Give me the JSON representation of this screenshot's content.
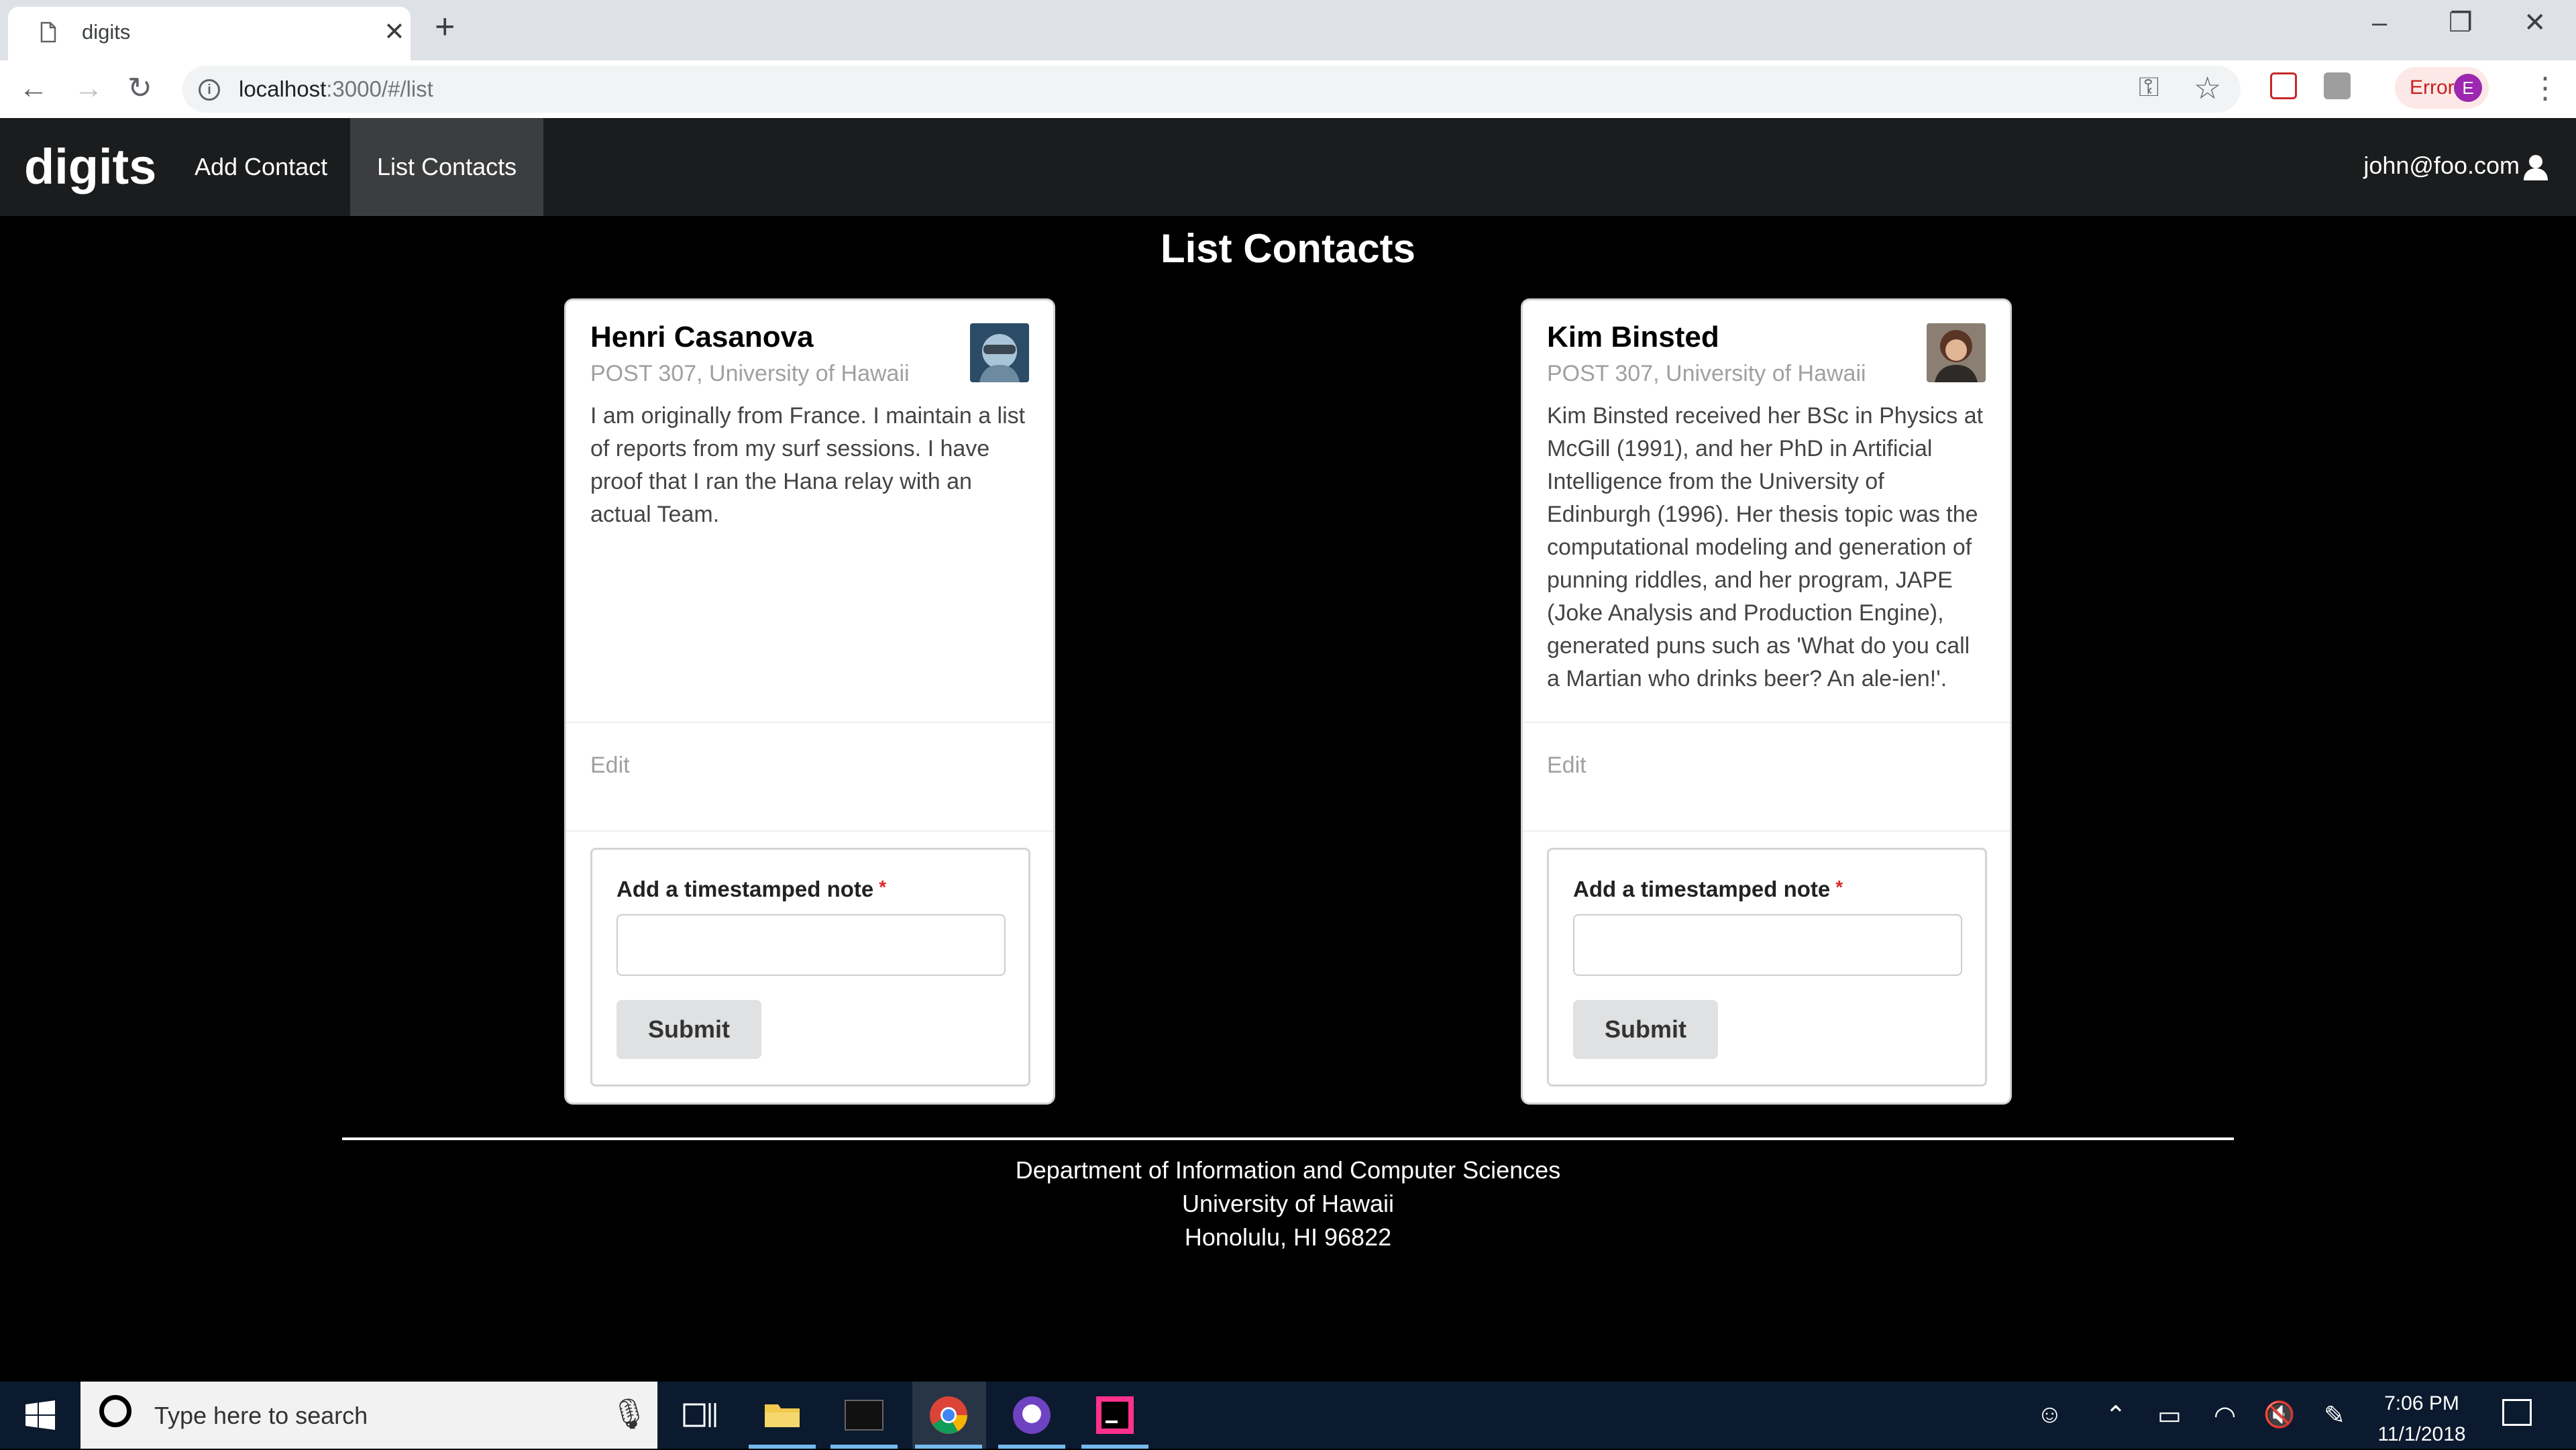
{
  "browser": {
    "tab_title": "digits",
    "url_host": "localhost",
    "url_rest": ":3000/#/list",
    "error_label": "Error",
    "profile_initial": "E"
  },
  "navbar": {
    "brand": "digits",
    "items": [
      {
        "label": "Add Contact",
        "active": false
      },
      {
        "label": "List Contacts",
        "active": true
      }
    ],
    "user": "john@foo.com"
  },
  "page": {
    "title": "List Contacts"
  },
  "contacts": [
    {
      "name": "Henri Casanova",
      "address": "POST 307, University of Hawaii",
      "description": "I am originally from France. I maintain a list of reports from my surf sessions. I have proof that I ran the Hana relay with an actual Team.",
      "edit_label": "Edit",
      "note_label": "Add a timestamped note",
      "note_value": "",
      "submit_label": "Submit"
    },
    {
      "name": "Kim Binsted",
      "address": "POST 307, University of Hawaii",
      "description": "Kim Binsted received her BSc in Physics at McGill (1991), and her PhD in Artificial Intelligence from the University of Edinburgh (1996). Her thesis topic was the computational modeling and generation of punning riddles, and her program, JAPE (Joke Analysis and Production Engine), generated puns such as 'What do you call a Martian who drinks beer? An ale-ien!'.",
      "edit_label": "Edit",
      "note_label": "Add a timestamped note",
      "note_value": "",
      "submit_label": "Submit"
    }
  ],
  "footer": {
    "line1": "Department of Information and Computer Sciences",
    "line2": "University of Hawaii",
    "line3": "Honolulu, HI 96822"
  },
  "taskbar": {
    "search_placeholder": "Type here to search",
    "time": "7:06 PM",
    "date": "11/1/2018"
  }
}
